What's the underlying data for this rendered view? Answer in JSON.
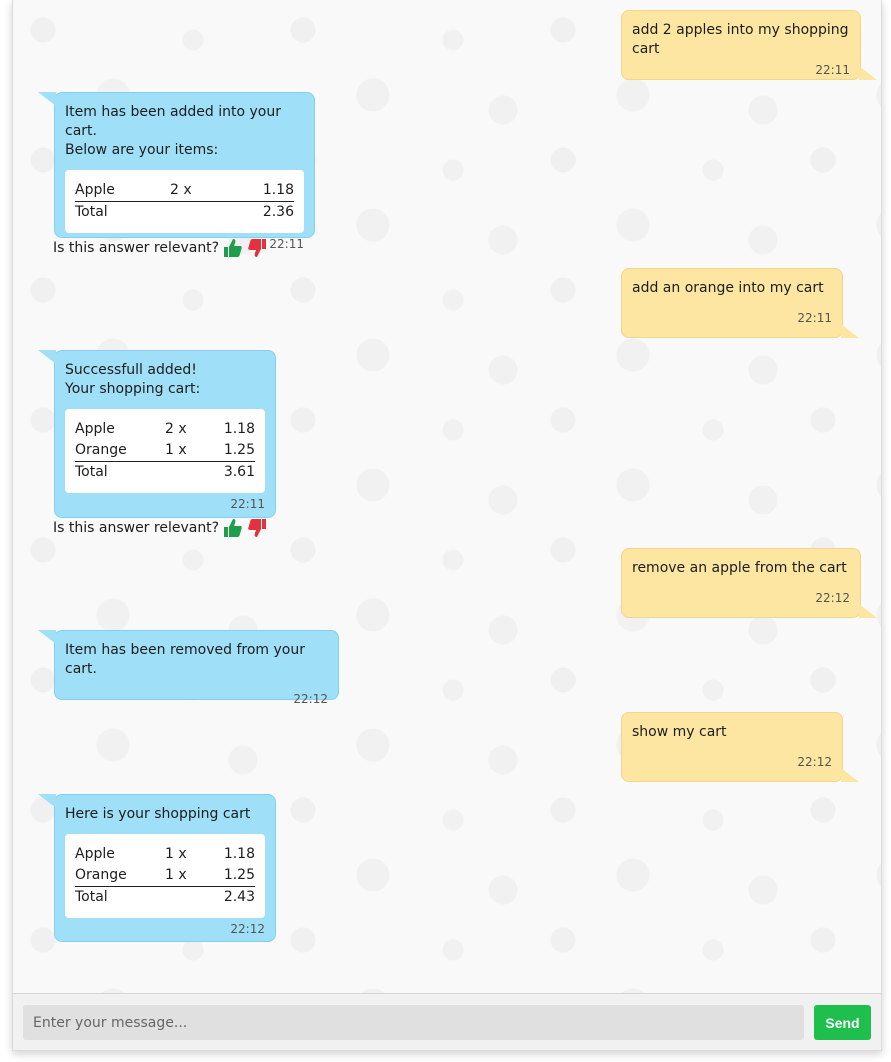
{
  "messages": [
    {
      "id": "m1",
      "from": "user",
      "text": "add 2 apples into my shopping cart",
      "time": "22:11"
    },
    {
      "id": "m2",
      "from": "bot",
      "text": "Item has been added into your cart.\nBelow are your items:",
      "cart": {
        "rows": [
          {
            "item": "Apple",
            "qty": "2 x",
            "price": "1.18"
          }
        ],
        "total_label": "Total",
        "total": "2.36"
      },
      "time": "22:11",
      "feedback": "Is this answer relevant?"
    },
    {
      "id": "m3",
      "from": "user",
      "text": "add an orange into my cart",
      "time": "22:11"
    },
    {
      "id": "m4",
      "from": "bot",
      "text": "Successfull added!\nYour shopping cart:",
      "cart": {
        "rows": [
          {
            "item": "Apple",
            "qty": "2 x",
            "price": "1.18"
          },
          {
            "item": "Orange",
            "qty": "1 x",
            "price": "1.25"
          }
        ],
        "total_label": "Total",
        "total": "3.61"
      },
      "time": "22:11",
      "feedback": "Is this answer relevant?"
    },
    {
      "id": "m5",
      "from": "user",
      "text": "remove an apple from the cart",
      "time": "22:12"
    },
    {
      "id": "m6",
      "from": "bot",
      "text": "Item has been removed from your cart.",
      "time": "22:12"
    },
    {
      "id": "m7",
      "from": "user",
      "text": "show my cart",
      "time": "22:12"
    },
    {
      "id": "m8",
      "from": "bot",
      "text": "Here is your shopping cart",
      "cart": {
        "rows": [
          {
            "item": "Apple",
            "qty": "1 x",
            "price": "1.18"
          },
          {
            "item": "Orange",
            "qty": "1 x",
            "price": "1.25"
          }
        ],
        "total_label": "Total",
        "total": "2.43"
      },
      "time": "22:12"
    }
  ],
  "composer": {
    "placeholder": "Enter your message...",
    "send_label": "Send"
  },
  "colors": {
    "bot_bubble": "#9fe0f8",
    "user_bubble": "#fde6a1",
    "thumbs_up": "#1e9e4a",
    "thumbs_down": "#e2323d",
    "send_button": "#1fbf4e"
  },
  "icons": {
    "thumbs_up": "thumbs-up-icon",
    "thumbs_down": "thumbs-down-icon"
  }
}
